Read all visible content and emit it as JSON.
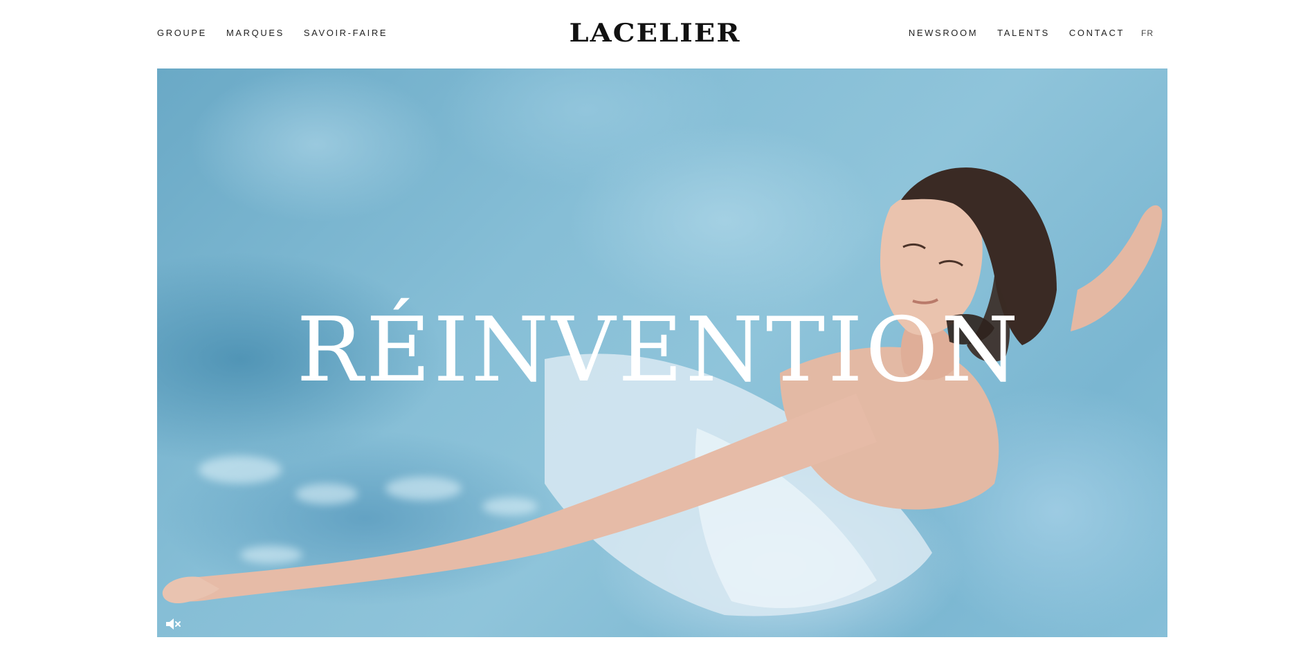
{
  "header": {
    "logo": "LACELIER",
    "nav_left": [
      {
        "label": "GROUPE"
      },
      {
        "label": "MARQUES"
      },
      {
        "label": "SAVOIR-FAIRE"
      }
    ],
    "nav_right": [
      {
        "label": "NEWSROOM"
      },
      {
        "label": "TALENTS"
      },
      {
        "label": "CONTACT"
      }
    ],
    "language": "FR"
  },
  "hero": {
    "title": "RÉINVENTION",
    "mute_icon": "speaker-muted-icon",
    "image": "woman-swimming-in-pool"
  },
  "colors": {
    "text": "#222222",
    "logo": "#111111",
    "water": "#86bed6",
    "hero_title": "#ffffff"
  }
}
